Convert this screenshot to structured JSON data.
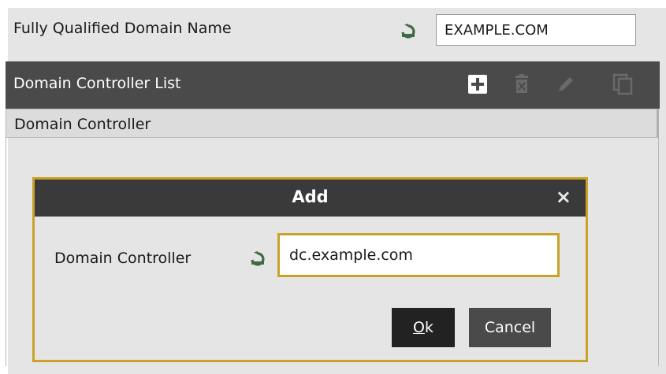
{
  "form": {
    "fqdn_label": "Fully Qualified Domain Name",
    "fqdn_value": "EXAMPLE.COM",
    "reset_icon": "reset-icon"
  },
  "list": {
    "title": "Domain Controller List",
    "column_header": "Domain Controller",
    "tools": [
      "add-icon",
      "delete-icon",
      "edit-icon",
      "clone-icon"
    ]
  },
  "dialog": {
    "title": "Add",
    "close_glyph": "×",
    "field_label": "Domain Controller",
    "field_value": "dc.example.com",
    "ok_mnemonic": "O",
    "ok_rest": "k",
    "cancel_label": "Cancel"
  },
  "colors": {
    "accent": "#c9a227",
    "header_bg": "#4a4a4a",
    "panel_bg": "#e5e5e5",
    "icon_green": "#3d6b45"
  }
}
